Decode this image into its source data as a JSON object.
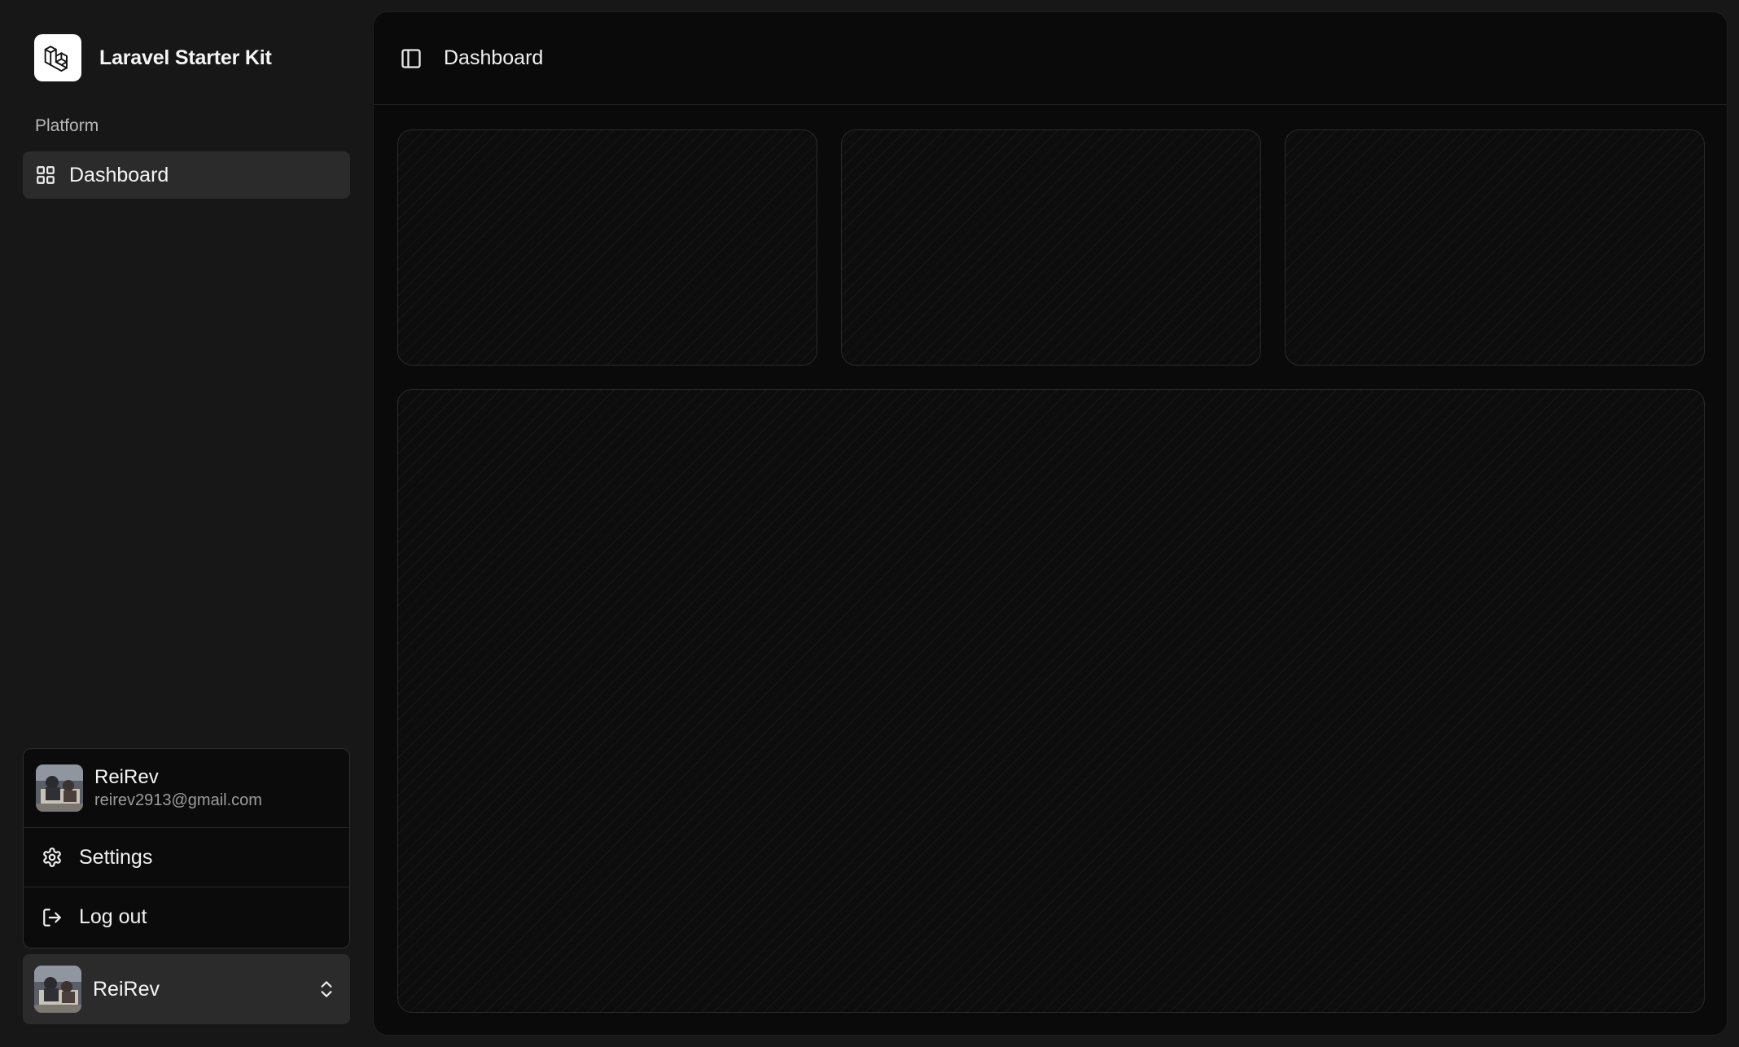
{
  "brand": {
    "name": "Laravel Starter Kit",
    "logo_icon": "laravel-logo-icon"
  },
  "sidebar": {
    "group_label": "Platform",
    "nav": [
      {
        "label": "Dashboard",
        "icon": "layout-grid-icon",
        "active": true
      }
    ]
  },
  "user_menu": {
    "name": "ReiRev",
    "email": "reirev2913@gmail.com",
    "items": [
      {
        "label": "Settings",
        "icon": "gear-icon"
      },
      {
        "label": "Log out",
        "icon": "log-out-icon"
      }
    ]
  },
  "user_trigger": {
    "name": "ReiRev",
    "icon": "chevrons-up-down-icon"
  },
  "header": {
    "toggle_icon": "panel-left-icon",
    "breadcrumb": "Dashboard"
  },
  "colors": {
    "background": "#171717",
    "main_background": "#0a0a0a",
    "active_item": "#2b2b2b",
    "text": "#f5f5f5",
    "muted_text": "#9c9c9c"
  }
}
